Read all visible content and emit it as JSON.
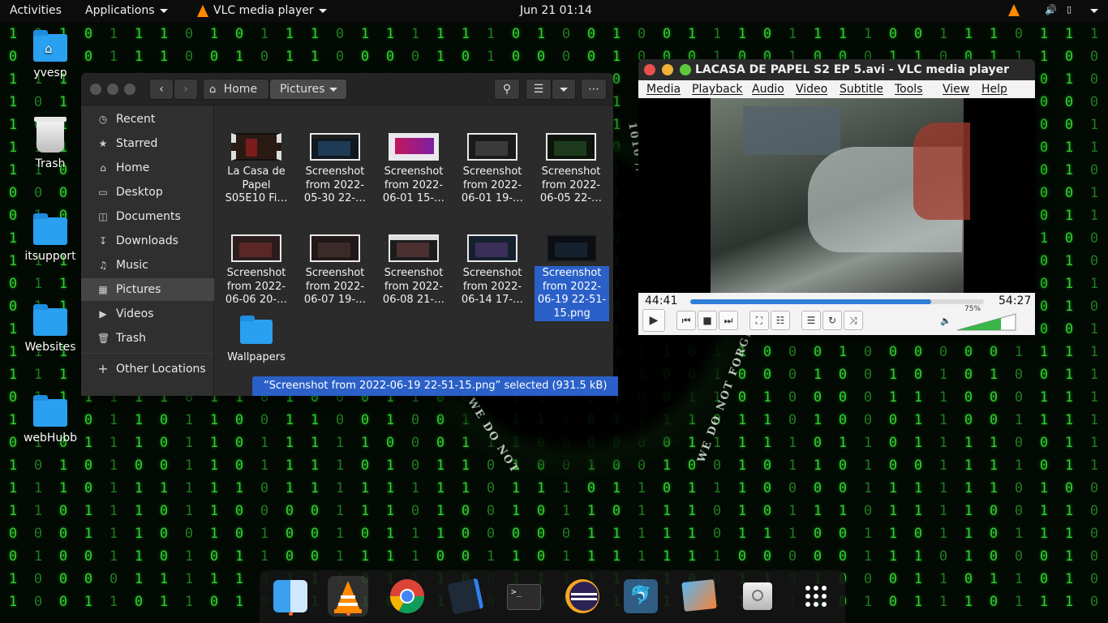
{
  "topbar": {
    "activities": "Activities",
    "applications": "Applications",
    "active_app": "VLC media player",
    "clock": "Jun 21  01:14"
  },
  "desktop_icons": [
    {
      "label": "yvesp",
      "icon": "home-folder-icon"
    },
    {
      "label": "Trash",
      "icon": "trash-icon"
    },
    {
      "label": "itsupport",
      "icon": "folder-icon"
    },
    {
      "label": "Websites",
      "icon": "folder-icon"
    },
    {
      "label": "webHubb",
      "icon": "folder-icon"
    }
  ],
  "file_manager": {
    "path": [
      "Home",
      "Pictures"
    ],
    "sidebar": [
      {
        "label": "Recent",
        "icon": "clock-icon"
      },
      {
        "label": "Starred",
        "icon": "star-icon"
      },
      {
        "label": "Home",
        "icon": "home-icon"
      },
      {
        "label": "Desktop",
        "icon": "desktop-icon"
      },
      {
        "label": "Documents",
        "icon": "documents-icon"
      },
      {
        "label": "Downloads",
        "icon": "download-icon"
      },
      {
        "label": "Music",
        "icon": "music-icon"
      },
      {
        "label": "Pictures",
        "icon": "pictures-icon",
        "active": true
      },
      {
        "label": "Videos",
        "icon": "video-icon"
      },
      {
        "label": "Trash",
        "icon": "trash-icon"
      },
      {
        "label": "Other Locations",
        "icon": "plus-icon"
      }
    ],
    "items": [
      {
        "name": "La Casa de Papel S05E10 Fi…",
        "type": "video"
      },
      {
        "name": "Screenshot from 2022-05-30 22-…",
        "type": "image"
      },
      {
        "name": "Screenshot from 2022-06-01 15-…",
        "type": "image"
      },
      {
        "name": "Screenshot from 2022-06-01 19-…",
        "type": "image"
      },
      {
        "name": "Screenshot from 2022-06-05 22-…",
        "type": "image"
      },
      {
        "name": "Screenshot from 2022-06-06 20-…",
        "type": "image"
      },
      {
        "name": "Screenshot from 2022-06-07 19-…",
        "type": "image"
      },
      {
        "name": "Screenshot from 2022-06-08 21-…",
        "type": "image"
      },
      {
        "name": "Screenshot from 2022-06-14 17-…",
        "type": "image"
      },
      {
        "name": "Screenshot from 2022-06-19 22-51-15.png",
        "type": "image",
        "selected": true
      },
      {
        "name": "Wallpapers",
        "type": "folder"
      }
    ],
    "status": "“Screenshot from 2022-06-19 22-51-15.png” selected  (931.5 kB)"
  },
  "vlc": {
    "title": "LACASA DE PAPEL S2 EP 5.avi - VLC media player",
    "menu": [
      "Media",
      "Playback",
      "Audio",
      "Video",
      "Subtitle",
      "Tools",
      "View",
      "Help"
    ],
    "elapsed": "44:41",
    "total": "54:27",
    "progress": 0.82,
    "volume": "75%",
    "volume_level": 0.75
  },
  "dock": [
    {
      "name": "finder-icon",
      "running": true
    },
    {
      "name": "vlc-icon",
      "running": true,
      "active": true
    },
    {
      "name": "chrome-icon",
      "running": false
    },
    {
      "name": "vscode-icon",
      "running": false
    },
    {
      "name": "terminal-icon",
      "running": false
    },
    {
      "name": "eclipse-icon",
      "running": false
    },
    {
      "name": "mysql-workbench-icon",
      "running": false
    },
    {
      "name": "image-viewer-icon",
      "running": false
    },
    {
      "name": "disk-icon",
      "running": false
    },
    {
      "name": "show-apps-icon",
      "running": false
    }
  ],
  "colors": {
    "accent": "#2a60c8",
    "matrix": "#2fd02f",
    "vlc_orange": "#ff8a00"
  }
}
